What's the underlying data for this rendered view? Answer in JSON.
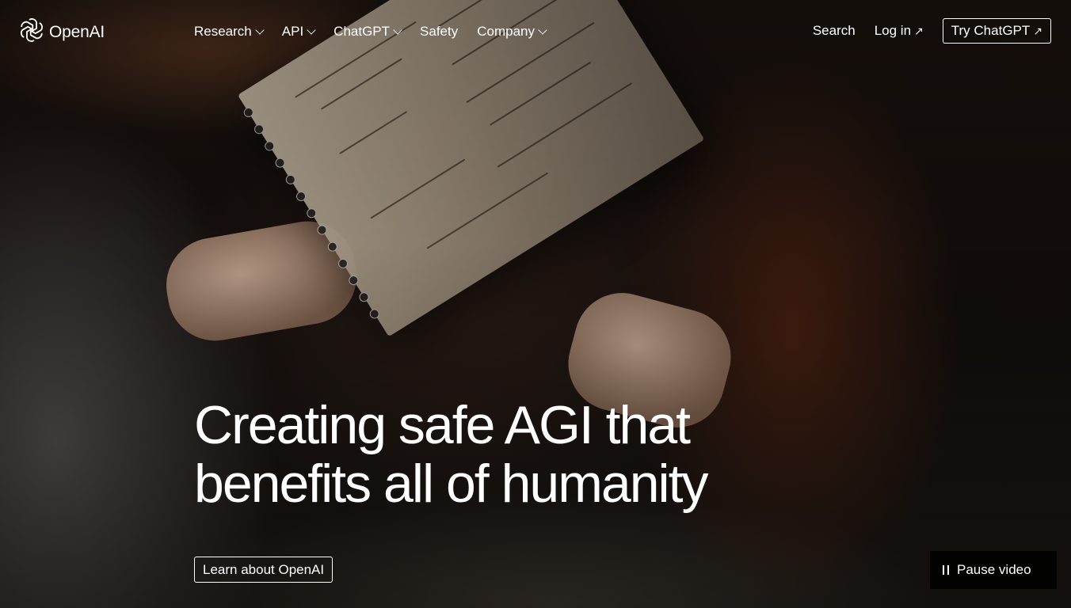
{
  "brand": {
    "name": "OpenAI"
  },
  "nav": {
    "items": [
      {
        "label": "Research",
        "has_dropdown": true
      },
      {
        "label": "API",
        "has_dropdown": true
      },
      {
        "label": "ChatGPT",
        "has_dropdown": true
      },
      {
        "label": "Safety",
        "has_dropdown": false
      },
      {
        "label": "Company",
        "has_dropdown": true
      }
    ]
  },
  "header_right": {
    "search_label": "Search",
    "login_label": "Log in",
    "try_label": "Try ChatGPT"
  },
  "hero": {
    "headline_line1": "Creating safe AGI that",
    "headline_line2": "benefits all of humanity",
    "cta_label": "Learn about OpenAI",
    "pause_label": "Pause video"
  },
  "icons": {
    "logo": "openai-logo-icon",
    "dropdown": "chevron-down-icon",
    "external": "arrow-up-right-icon",
    "pause": "pause-icon"
  },
  "colors": {
    "text": "#ffffff",
    "background": "#000000"
  }
}
